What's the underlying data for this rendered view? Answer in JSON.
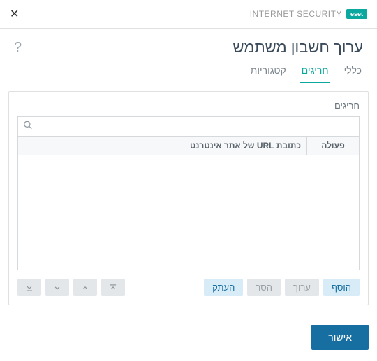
{
  "brand": {
    "logo": "eset",
    "product": "INTERNET SECURITY"
  },
  "dialog": {
    "title": "ערוך חשבון משתמש",
    "help": "?"
  },
  "tabs": {
    "general": "כללי",
    "exceptions": "חריגים",
    "categories": "קטגוריות"
  },
  "section": {
    "heading": "חריגים"
  },
  "table": {
    "col_action": "פעולה",
    "col_url": "כתובת URL של אתר אינטרנט"
  },
  "buttons": {
    "add": "הוסף",
    "edit": "ערוך",
    "remove": "הסר",
    "copy": "העתק",
    "ok": "אישור"
  }
}
